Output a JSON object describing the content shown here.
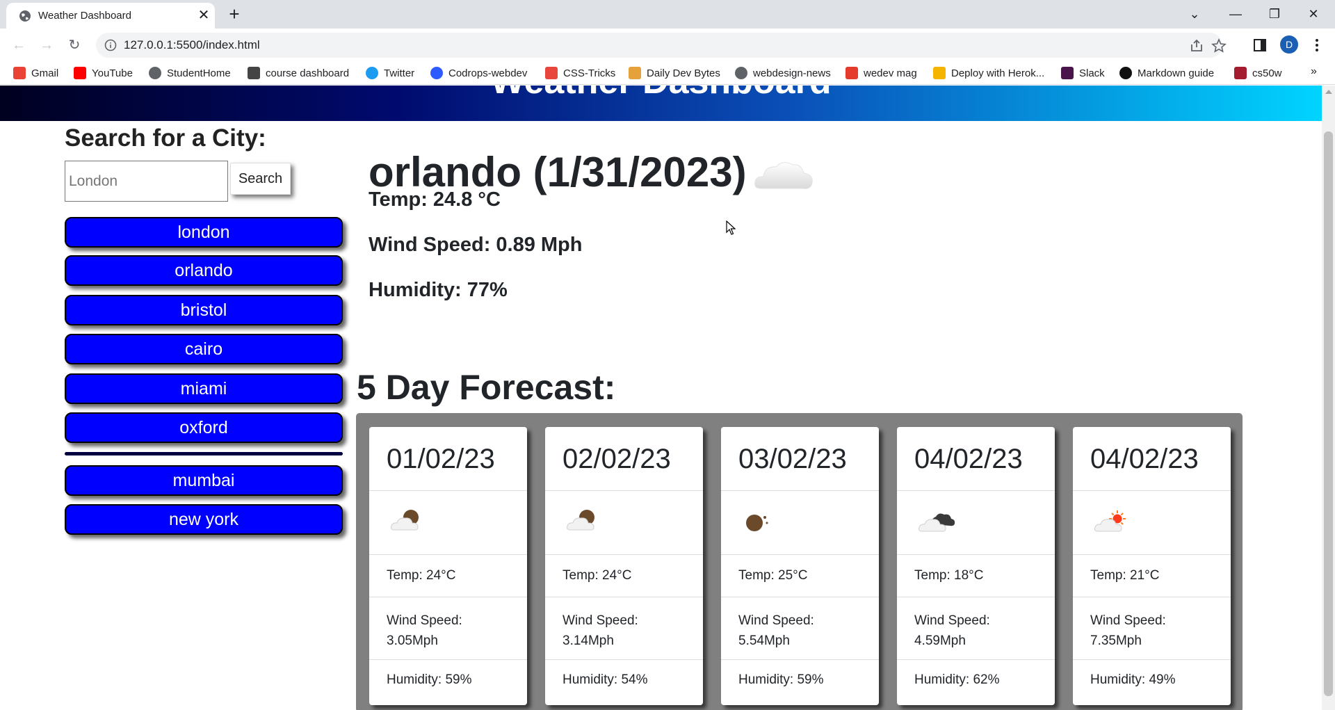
{
  "browser": {
    "tab_title": "Weather Dashboard",
    "url": "127.0.0.1:5500/index.html",
    "profile_initial": "D",
    "bookmarks": [
      {
        "label": "Gmail",
        "icon": "gmail-icon",
        "color": "#ea4335"
      },
      {
        "label": "YouTube",
        "icon": "youtube-icon",
        "color": "#ff0000"
      },
      {
        "label": "StudentHome",
        "icon": "globe-icon",
        "color": "#5f6368"
      },
      {
        "label": "course dashboard",
        "icon": "course-icon",
        "color": "#444444"
      },
      {
        "label": "Twitter",
        "icon": "twitter-icon",
        "color": "#1d9bf0"
      },
      {
        "label": "Codrops-webdev",
        "icon": "codrops-icon",
        "color": "#2e5bff"
      },
      {
        "label": "CSS-Tricks",
        "icon": "css-tricks-icon",
        "color": "#e8453c"
      },
      {
        "label": "Daily Dev Bytes",
        "icon": "daily-dev-icon",
        "color": "#e5a23a"
      },
      {
        "label": "webdesign-news",
        "icon": "globe-icon",
        "color": "#5f6368"
      },
      {
        "label": "wedev mag",
        "icon": "smashing-icon",
        "color": "#e53b2c"
      },
      {
        "label": "Deploy with Herok...",
        "icon": "heroku-icon",
        "color": "#f4b400"
      },
      {
        "label": "Slack",
        "icon": "slack-icon",
        "color": "#4a154b"
      },
      {
        "label": "Markdown guide",
        "icon": "markdown-icon",
        "color": "#111111"
      },
      {
        "label": "cs50w",
        "icon": "harvard-icon",
        "color": "#a51c30"
      }
    ],
    "more_bookmarks": "»"
  },
  "app": {
    "header_title": "Weather Dashboard",
    "search_heading": "Search for a City:",
    "search_placeholder": "London",
    "search_button": "Search",
    "history": [
      "london",
      "orlando",
      "bristol",
      "cairo",
      "miami",
      "oxford",
      "mumbai",
      "new york"
    ],
    "current": {
      "title": "orlando (1/31/2023)",
      "icon": "cloud-icon",
      "temp": "Temp: 24.8 °C",
      "wind": "Wind Speed: 0.89 Mph",
      "humidity": "Humidity: 77%"
    },
    "forecast_heading": "5 Day Forecast:",
    "forecast": [
      {
        "date": "01/02/23",
        "icon": "night-partly-cloudy-icon",
        "temp": "Temp: 24°C",
        "wind": "Wind Speed: 3.05Mph",
        "humidity": "Humidity: 59%"
      },
      {
        "date": "02/02/23",
        "icon": "night-partly-cloudy-icon",
        "temp": "Temp: 24°C",
        "wind": "Wind Speed: 3.14Mph",
        "humidity": "Humidity: 54%"
      },
      {
        "date": "03/02/23",
        "icon": "night-clear-icon",
        "temp": "Temp: 25°C",
        "wind": "Wind Speed: 5.54Mph",
        "humidity": "Humidity: 59%"
      },
      {
        "date": "04/02/23",
        "icon": "broken-clouds-icon",
        "temp": "Temp: 18°C",
        "wind": "Wind Speed: 4.59Mph",
        "humidity": "Humidity: 62%"
      },
      {
        "date": "04/02/23",
        "icon": "day-partly-cloudy-icon",
        "temp": "Temp: 21°C",
        "wind": "Wind Speed: 7.35Mph",
        "humidity": "Humidity: 49%"
      }
    ]
  },
  "colors": {
    "city_button": "#0000ff",
    "forecast_panel": "#808080"
  }
}
